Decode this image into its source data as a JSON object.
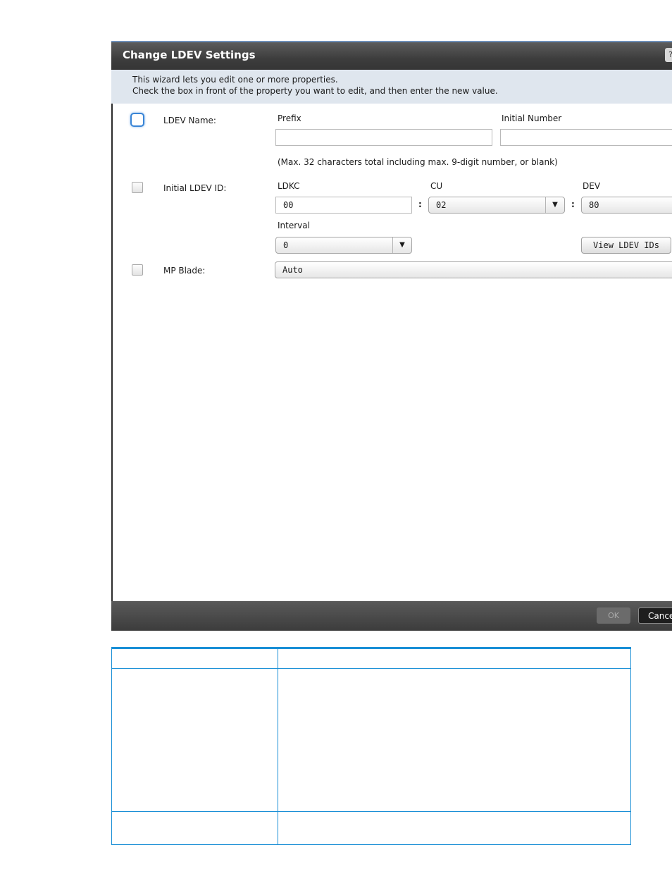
{
  "dialog": {
    "title": "Change LDEV Settings",
    "help_label": "?",
    "intro_line1": "This wizard lets you edit one or more properties.",
    "intro_line2": "Check the  box in front of the property you want to edit, and then enter the new value.",
    "ldev_name": {
      "label": "LDEV Name:",
      "prefix_label": "Prefix",
      "prefix_value": "",
      "initial_number_label": "Initial Number",
      "initial_number_value": "",
      "hint": "(Max. 32 characters total including max. 9-digit number, or blank)"
    },
    "initial_ldev_id": {
      "label": "Initial LDEV ID:",
      "ldkc_label": "LDKC",
      "ldkc_value": "00",
      "cu_label": "CU",
      "cu_value": "02",
      "dev_label": "DEV",
      "dev_value": "80",
      "separator": ":",
      "interval_label": "Interval",
      "interval_value": "0",
      "view_button": "View LDEV IDs"
    },
    "mp_blade": {
      "label": "MP Blade:",
      "value": "Auto"
    },
    "footer": {
      "ok_label": "OK",
      "cancel_label": "Cancel"
    }
  },
  "table": {
    "rows": [
      {
        "col1": "",
        "col2": ""
      },
      {
        "col1": "",
        "col2": ""
      },
      {
        "col1": "",
        "col2": ""
      }
    ]
  },
  "colors": {
    "accent_blue": "#1a8fd6",
    "titlebar": "#3d3d3d",
    "intro_bg": "#dfe6ee"
  }
}
